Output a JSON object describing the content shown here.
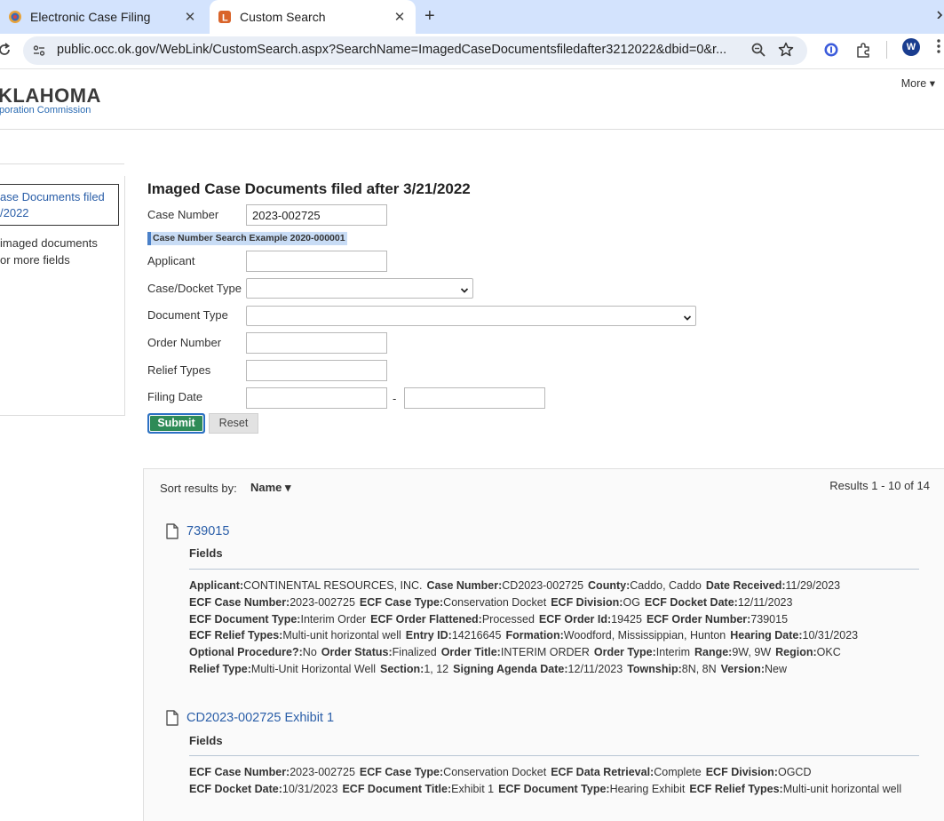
{
  "browser": {
    "tabs": [
      {
        "title": "Electronic Case Filing",
        "favicon": "seal-icon",
        "active": false
      },
      {
        "title": "Custom Search",
        "favicon": "laserfiche-icon",
        "active": true
      }
    ],
    "new_tab_symbol": "+",
    "close_symbol": "✕",
    "url": "public.occ.ok.gov/WebLink/CustomSearch.aspx?SearchName=ImagedCaseDocumentsfiledafter3212022&dbid=0&r...",
    "avatar_letter": "W"
  },
  "header": {
    "logo_main": "KLAHOMA",
    "logo_sub": "poration Commission",
    "more_label": "More ▾"
  },
  "left_panel": {
    "selected_lines": [
      "ase Documents filed",
      "/2022"
    ],
    "description_lines": [
      "imaged documents",
      "or more fields"
    ]
  },
  "form": {
    "title": "Imaged Case Documents filed after 3/21/2022",
    "case_number_label": "Case Number",
    "case_number_value": "2023-002725",
    "example_text": "Case Number Search Example 2020-000001",
    "applicant_label": "Applicant",
    "case_docket_type_label": "Case/Docket Type",
    "document_type_label": "Document Type",
    "order_number_label": "Order Number",
    "relief_types_label": "Relief Types",
    "filing_date_label": "Filing Date",
    "date_separator": "-",
    "submit_label": "Submit",
    "reset_label": "Reset"
  },
  "results": {
    "sort_label": "Sort results by:",
    "sort_value": "Name ▾",
    "count_text": "Results  1 - 10 of 14",
    "fields_label": "Fields",
    "items": [
      {
        "title": "739015",
        "lines": [
          [
            [
              "Applicant:",
              "CONTINENTAL RESOURCES, INC."
            ],
            [
              "Case Number:",
              "CD2023-002725"
            ],
            [
              "County:",
              "Caddo, Caddo"
            ],
            [
              "Date Received:",
              "11/29/2023"
            ]
          ],
          [
            [
              "ECF Case Number:",
              "2023-002725"
            ],
            [
              "ECF Case Type:",
              "Conservation Docket"
            ],
            [
              "ECF Division:",
              "OG"
            ],
            [
              "ECF Docket Date:",
              "12/11/2023"
            ]
          ],
          [
            [
              "ECF Document Type:",
              "Interim Order"
            ],
            [
              "ECF Order Flattened:",
              "Processed"
            ],
            [
              "ECF Order Id:",
              "19425"
            ],
            [
              "ECF Order Number:",
              "739015"
            ]
          ],
          [
            [
              "ECF Relief Types:",
              "Multi-unit horizontal well"
            ],
            [
              "Entry ID:",
              "14216645"
            ],
            [
              "Formation:",
              "Woodford, Mississippian, Hunton"
            ],
            [
              "Hearing Date:",
              "10/31/2023"
            ]
          ],
          [
            [
              "Optional Procedure?:",
              "No"
            ],
            [
              "Order Status:",
              "Finalized"
            ],
            [
              "Order Title:",
              "INTERIM ORDER"
            ],
            [
              "Order Type:",
              "Interim"
            ],
            [
              "Range:",
              "9W, 9W"
            ],
            [
              "Region:",
              "OKC"
            ]
          ],
          [
            [
              "Relief Type:",
              "Multi-Unit Horizontal Well"
            ],
            [
              "Section:",
              "1, 12"
            ],
            [
              "Signing Agenda Date:",
              "12/11/2023"
            ],
            [
              "Township:",
              "8N, 8N"
            ],
            [
              "Version:",
              "New"
            ]
          ]
        ]
      },
      {
        "title": "CD2023-002725 Exhibit 1",
        "lines": [
          [
            [
              "ECF Case Number:",
              "2023-002725"
            ],
            [
              "ECF Case Type:",
              "Conservation Docket"
            ],
            [
              "ECF Data Retrieval:",
              "Complete"
            ],
            [
              "ECF Division:",
              "OGCD"
            ]
          ],
          [
            [
              "ECF Docket Date:",
              "10/31/2023"
            ],
            [
              "ECF Document Title:",
              "Exhibit 1"
            ],
            [
              "ECF Document Type:",
              "Hearing Exhibit"
            ],
            [
              "ECF Relief Types:",
              "Multi-unit horizontal well"
            ]
          ]
        ]
      }
    ]
  }
}
